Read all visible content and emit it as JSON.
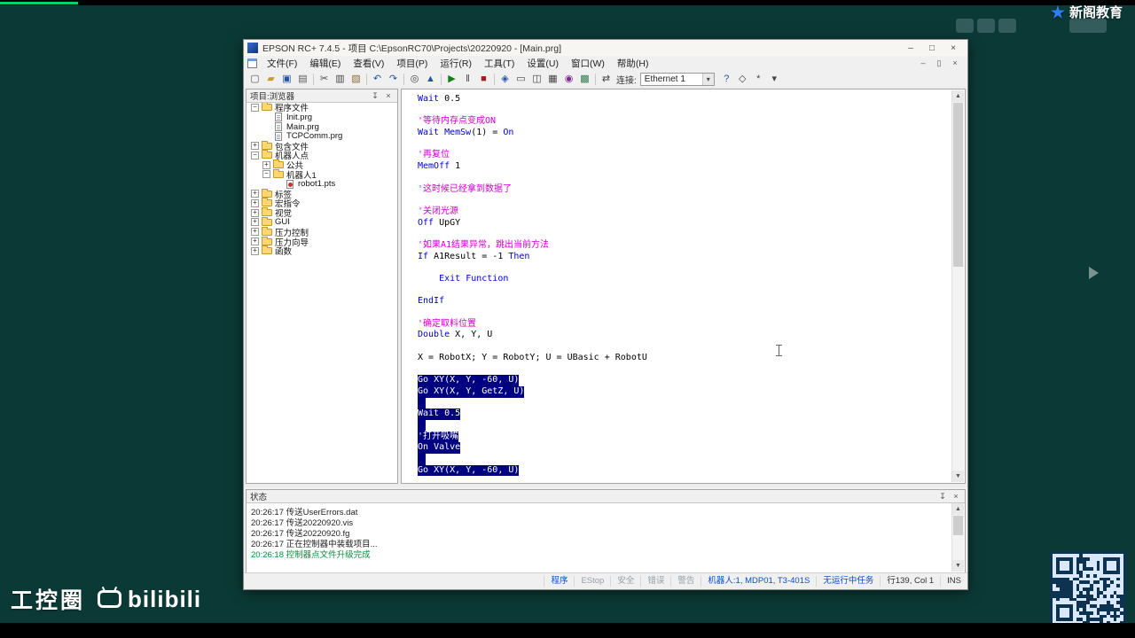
{
  "overlay": {
    "brand": "新阁教育",
    "watermark_name": "工控圈",
    "watermark_bili": "bilibili"
  },
  "window": {
    "title": "EPSON RC+ 7.4.5 - 项目 C:\\EpsonRC70\\Projects\\20220920 - [Main.prg]",
    "controls": {
      "min": "–",
      "max": "□",
      "close": "×"
    },
    "menu": [
      "文件(F)",
      "编辑(E)",
      "查看(V)",
      "项目(P)",
      "运行(R)",
      "工具(T)",
      "设置(U)",
      "窗口(W)",
      "帮助(H)"
    ],
    "mdi_controls": {
      "min": "–",
      "restore": "▯",
      "close": "×"
    }
  },
  "toolbar": {
    "items": [
      {
        "name": "new-icon",
        "glyph": "▢",
        "color": "#5a5a5a"
      },
      {
        "name": "open-icon",
        "glyph": "▰",
        "color": "#c89b2e"
      },
      {
        "name": "save-icon",
        "glyph": "▣",
        "color": "#2455a4"
      },
      {
        "name": "print-icon",
        "glyph": "▤",
        "color": "#5a5a5a"
      },
      {
        "sep": true
      },
      {
        "name": "cut-icon",
        "glyph": "✂",
        "color": "#444444"
      },
      {
        "name": "copy-icon",
        "glyph": "▥",
        "color": "#444444"
      },
      {
        "name": "paste-icon",
        "glyph": "▧",
        "color": "#8a6d3b"
      },
      {
        "sep": true
      },
      {
        "name": "undo-icon",
        "glyph": "↶",
        "color": "#2455a4"
      },
      {
        "name": "redo-icon",
        "glyph": "↷",
        "color": "#2455a4"
      },
      {
        "sep": true
      },
      {
        "name": "find-icon",
        "glyph": "◎",
        "color": "#444444"
      },
      {
        "name": "build-icon",
        "glyph": "▲",
        "color": "#2455a4"
      },
      {
        "sep": true
      },
      {
        "name": "start-icon",
        "glyph": "▶",
        "color": "#148014"
      },
      {
        "name": "pause-icon",
        "glyph": "‖",
        "color": "#444444"
      },
      {
        "name": "stop-icon",
        "glyph": "■",
        "color": "#a02020"
      },
      {
        "sep": true
      },
      {
        "name": "robot-manager-icon",
        "glyph": "◈",
        "color": "#2455a4"
      },
      {
        "name": "command-window-icon",
        "glyph": "▭",
        "color": "#444444"
      },
      {
        "name": "io-monitor-icon",
        "glyph": "◫",
        "color": "#444444"
      },
      {
        "name": "task-manager-icon",
        "glyph": "▦",
        "color": "#444444"
      },
      {
        "name": "vision-icon",
        "glyph": "◉",
        "color": "#7b2d8b"
      },
      {
        "name": "gui-builder-icon",
        "glyph": "▩",
        "color": "#2d7b4f"
      },
      {
        "sep": true
      },
      {
        "name": "connect-icon",
        "glyph": "⇄",
        "color": "#444444"
      }
    ],
    "connect_label": "连接:",
    "connection_value": "Ethernet 1",
    "right_items": [
      {
        "name": "help-icon",
        "glyph": "?",
        "color": "#2455a4"
      },
      {
        "name": "simulator-icon",
        "glyph": "◇",
        "color": "#444444"
      },
      {
        "name": "options-icon",
        "glyph": "*",
        "color": "#444444"
      },
      {
        "name": "toolbar-overflow-icon",
        "glyph": "▾",
        "color": "#444444"
      }
    ]
  },
  "explorer": {
    "title": "项目:浏览器",
    "items": [
      {
        "depth": 0,
        "type": "folder-open",
        "label": "程序文件",
        "exp": "minus"
      },
      {
        "depth": 1,
        "type": "prg-file",
        "label": "Init.prg",
        "exp": "none"
      },
      {
        "depth": 1,
        "type": "prg-file",
        "label": "Main.prg",
        "exp": "none"
      },
      {
        "depth": 1,
        "type": "prg-file",
        "label": "TCPComm.prg",
        "exp": "none"
      },
      {
        "depth": 0,
        "type": "folder",
        "label": "包含文件",
        "exp": "plus"
      },
      {
        "depth": 0,
        "type": "folder-open",
        "label": "机器人点",
        "exp": "minus"
      },
      {
        "depth": 1,
        "type": "folder",
        "label": "公共",
        "exp": "plus"
      },
      {
        "depth": 1,
        "type": "folder-open",
        "label": "机器人1",
        "exp": "minus"
      },
      {
        "depth": 2,
        "type": "pts-file",
        "label": "robot1.pts",
        "exp": "none"
      },
      {
        "depth": 0,
        "type": "folder",
        "label": "标签",
        "exp": "plus"
      },
      {
        "depth": 0,
        "type": "folder",
        "label": "宏指令",
        "exp": "plus"
      },
      {
        "depth": 0,
        "type": "folder",
        "label": "视觉",
        "exp": "plus"
      },
      {
        "depth": 0,
        "type": "folder",
        "label": "GUI",
        "exp": "plus"
      },
      {
        "depth": 0,
        "type": "folder",
        "label": "压力控制",
        "exp": "plus"
      },
      {
        "depth": 0,
        "type": "folder",
        "label": "压力向导",
        "exp": "plus"
      },
      {
        "depth": 0,
        "type": "folder",
        "label": "函数",
        "exp": "plus"
      }
    ]
  },
  "editor": {
    "lines": [
      {
        "seg": [
          [
            "k",
            "Wait"
          ],
          [
            "p",
            " 0.5"
          ]
        ]
      },
      {
        "seg": []
      },
      {
        "seg": [
          [
            "c",
            "'等待内存点变成ON"
          ]
        ]
      },
      {
        "seg": [
          [
            "k",
            "Wait MemSw"
          ],
          [
            "p",
            "(1) = "
          ],
          [
            "k",
            "On"
          ]
        ]
      },
      {
        "seg": []
      },
      {
        "seg": [
          [
            "c",
            "'再复位"
          ]
        ]
      },
      {
        "seg": [
          [
            "k",
            "MemOff"
          ],
          [
            "p",
            " 1"
          ]
        ]
      },
      {
        "seg": []
      },
      {
        "seg": [
          [
            "c",
            "'这时候已经拿到数据了"
          ]
        ]
      },
      {
        "seg": []
      },
      {
        "seg": [
          [
            "c",
            "'关闭光源"
          ]
        ]
      },
      {
        "seg": [
          [
            "k",
            "Off"
          ],
          [
            "p",
            " UpGY"
          ]
        ]
      },
      {
        "seg": []
      },
      {
        "seg": [
          [
            "c",
            "'如果A1结果异常，跳出当前方法"
          ]
        ]
      },
      {
        "seg": [
          [
            "k",
            "If"
          ],
          [
            "p",
            " A1Result = -1 "
          ],
          [
            "k",
            "Then"
          ]
        ]
      },
      {
        "seg": []
      },
      {
        "seg": [
          [
            "p",
            "    "
          ],
          [
            "k",
            "Exit Function"
          ]
        ]
      },
      {
        "seg": []
      },
      {
        "seg": [
          [
            "k",
            "EndIf"
          ]
        ]
      },
      {
        "seg": []
      },
      {
        "seg": [
          [
            "c",
            "'确定取料位置"
          ]
        ]
      },
      {
        "seg": [
          [
            "k",
            "Double"
          ],
          [
            "p",
            " X, Y, U"
          ]
        ]
      },
      {
        "seg": []
      },
      {
        "seg": [
          [
            "p",
            "X = RobotX; Y = RobotY; U = UBasic + RobotU"
          ]
        ]
      },
      {
        "seg": []
      },
      {
        "sel": true,
        "seg": [
          [
            "k",
            "Go"
          ],
          [
            "p",
            " XY(X, Y, -60, U)"
          ]
        ]
      },
      {
        "sel": true,
        "seg": [
          [
            "k",
            "Go"
          ],
          [
            "p",
            " XY(X, Y, GetZ, U)"
          ]
        ]
      },
      {
        "sel": true,
        "seg": []
      },
      {
        "sel": true,
        "seg": [
          [
            "k",
            "Wait"
          ],
          [
            "p",
            " 0.5"
          ]
        ]
      },
      {
        "sel": true,
        "seg": []
      },
      {
        "sel": true,
        "seg": [
          [
            "c",
            "'打开吸嘴"
          ]
        ]
      },
      {
        "sel": true,
        "seg": [
          [
            "k",
            "On"
          ],
          [
            "p",
            " Valve"
          ]
        ]
      },
      {
        "sel": true,
        "seg": []
      },
      {
        "sel": true,
        "seg": [
          [
            "k",
            "Go"
          ],
          [
            "p",
            " XY(X, Y, -60, U)"
          ]
        ]
      }
    ]
  },
  "status_panel": {
    "title": "状态",
    "logs": [
      {
        "text": "20:26:17 传送UserErrors.dat",
        "color": "normal"
      },
      {
        "text": "20:26:17 传送20220920.vis",
        "color": "normal"
      },
      {
        "text": "20:26:17 传送20220920.fg",
        "color": "normal"
      },
      {
        "text": "20:26:17 正在控制器中装载项目...",
        "color": "normal"
      },
      {
        "text": "20:26:18 控制器点文件升级完成",
        "color": "green"
      }
    ]
  },
  "statusbar": {
    "items": [
      {
        "text": "程序",
        "style": "blue"
      },
      {
        "text": "EStop",
        "style": "dim"
      },
      {
        "text": "安全",
        "style": "dim"
      },
      {
        "text": "错误",
        "style": "dim"
      },
      {
        "text": "警告",
        "style": "dim"
      },
      {
        "text": "机器人:1, MDP01, T3-401S",
        "style": "blue"
      },
      {
        "text": "无运行中任务",
        "style": "blue"
      },
      {
        "text": "行139, Col 1",
        "style": "dark"
      },
      {
        "text": "INS",
        "style": "dark"
      }
    ]
  }
}
